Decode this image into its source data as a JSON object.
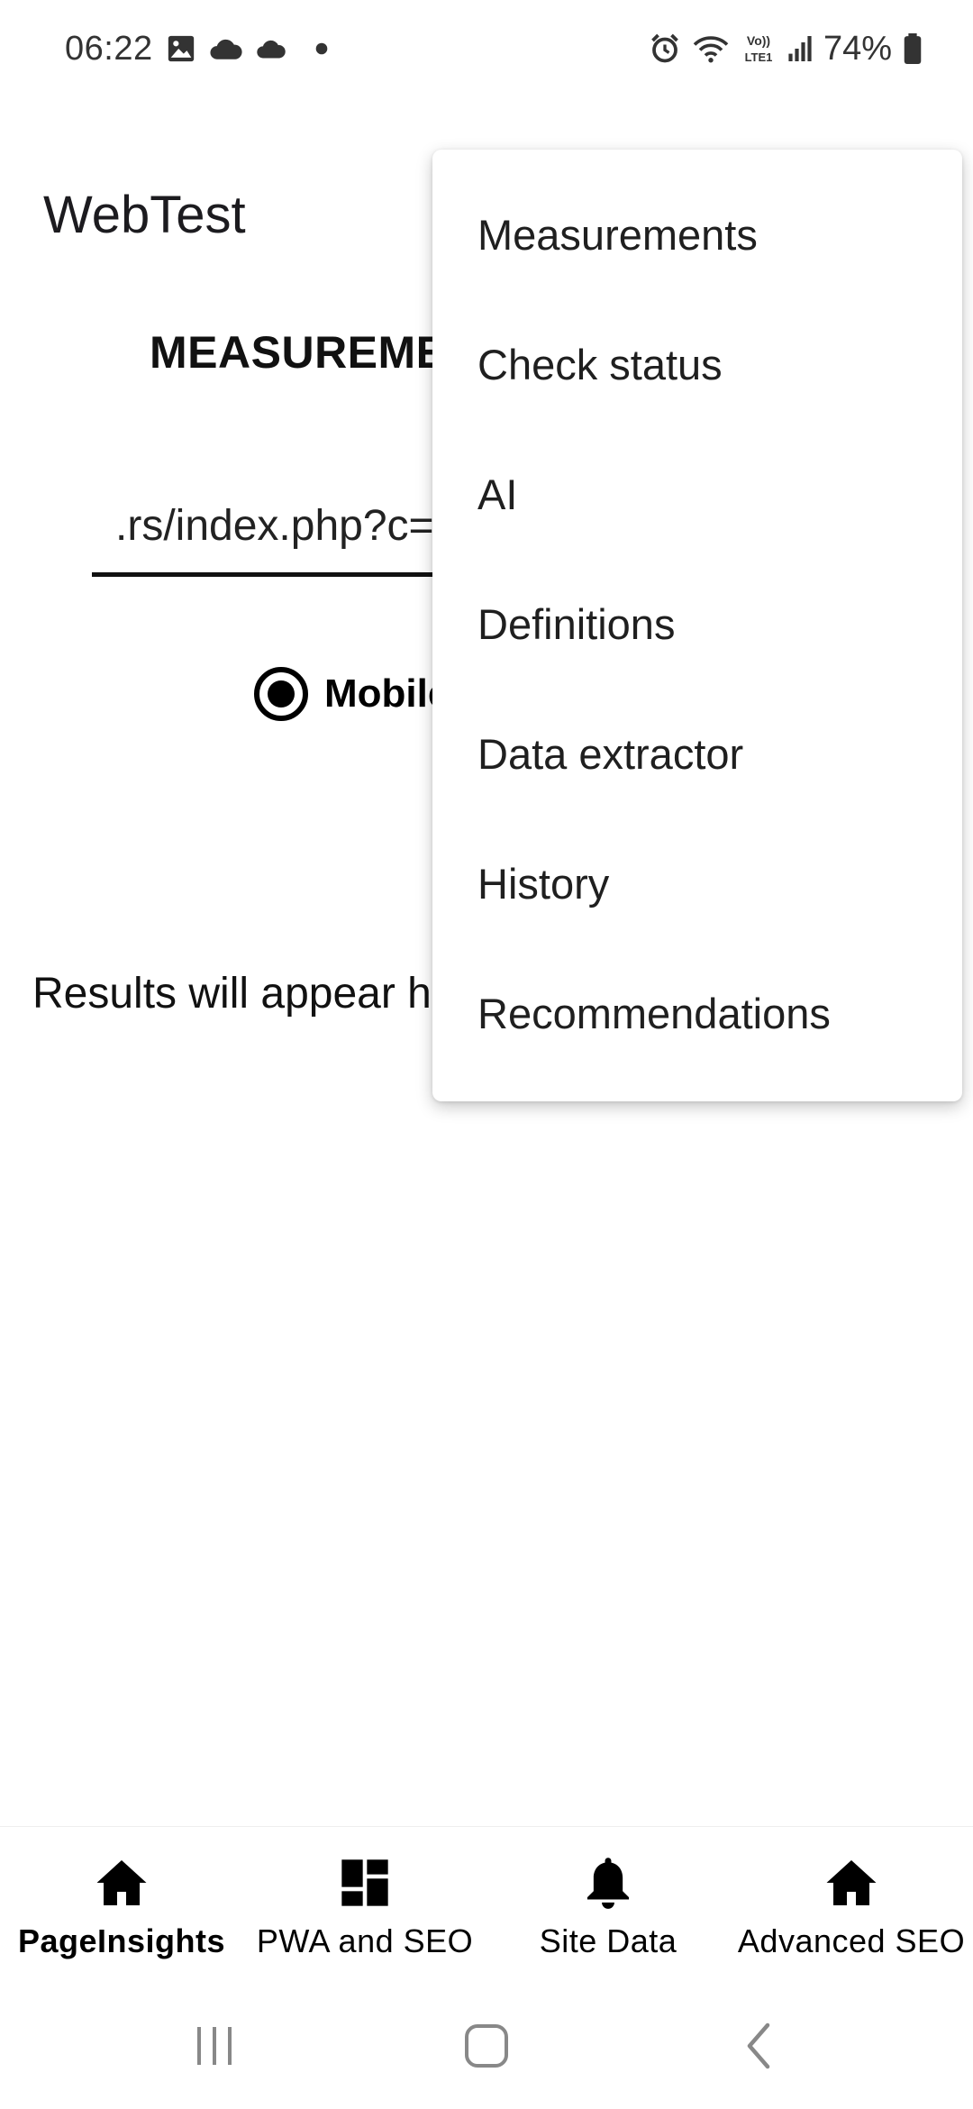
{
  "status_bar": {
    "time": "06:22",
    "battery_percent": "74%",
    "left_icons": [
      "image-icon",
      "cloud-icon",
      "cloud-icon",
      "dot-icon"
    ],
    "right_icons": [
      "alarm-icon",
      "wifi-icon",
      "volte-icon",
      "signal-icon",
      "battery-icon"
    ],
    "volte_text": "Vo)) LTE1"
  },
  "app_bar": {
    "title": "WebTest"
  },
  "main": {
    "heading": "MEASUREMENTS",
    "url_value": ".rs/index.php?c=",
    "radio_mobile_label": "Mobile",
    "radio_mobile_selected": true,
    "results_placeholder": "Results will appear here"
  },
  "overflow_menu": {
    "items": [
      {
        "label": "Measurements"
      },
      {
        "label": "Check status"
      },
      {
        "label": "AI"
      },
      {
        "label": "Definitions"
      },
      {
        "label": "Data extractor"
      },
      {
        "label": "History"
      },
      {
        "label": "Recommendations"
      }
    ]
  },
  "bottom_nav": {
    "items": [
      {
        "label": "PageInsights",
        "icon": "home-icon",
        "active": true
      },
      {
        "label": "PWA and SEO",
        "icon": "dashboard-icon",
        "active": false
      },
      {
        "label": "Site Data",
        "icon": "bell-icon",
        "active": false
      },
      {
        "label": "Advanced SEO",
        "icon": "home-icon",
        "active": false
      }
    ]
  },
  "system_nav": {
    "buttons": [
      "recents-icon",
      "home-button-icon",
      "back-icon"
    ]
  }
}
